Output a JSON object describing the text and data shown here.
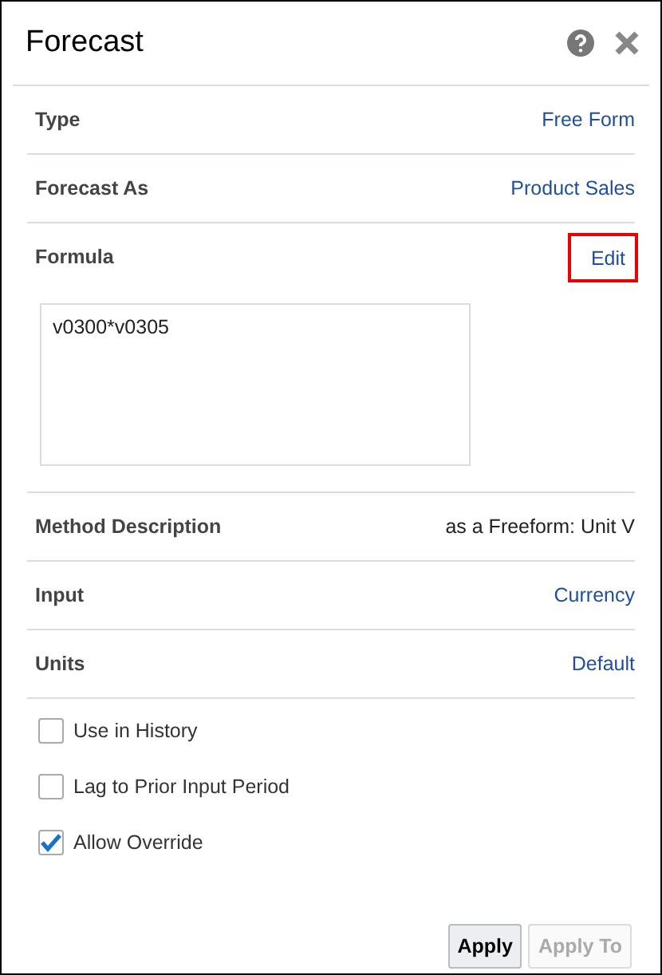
{
  "window": {
    "title": "Forecast"
  },
  "rows": [
    {
      "label": "Type",
      "value": "Free Form",
      "kind": "link"
    },
    {
      "label": "Forecast As",
      "value": "Product Sales",
      "kind": "link"
    },
    {
      "label": "Formula",
      "value": "Edit",
      "kind": "link",
      "highlighted": true,
      "formula": "v0300*v0305"
    },
    {
      "label": "Method Description",
      "value": "as a Freeform:  Unit V",
      "kind": "text"
    },
    {
      "label": "Input",
      "value": "Currency",
      "kind": "link"
    },
    {
      "label": "Units",
      "value": "Default",
      "kind": "link"
    }
  ],
  "options": [
    {
      "label": "Use in History",
      "checked": false
    },
    {
      "label": "Lag to Prior Input Period",
      "checked": false
    },
    {
      "label": "Allow Override",
      "checked": true
    }
  ],
  "buttons": [
    {
      "label": "Apply",
      "disabled": false
    },
    {
      "label": "Apply To",
      "disabled": true
    }
  ]
}
